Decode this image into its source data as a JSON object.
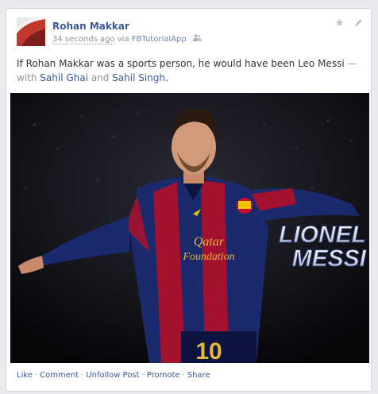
{
  "post": {
    "author": "Rohan Makkar",
    "time": "34 seconds ago",
    "via_label": "via",
    "app": "FBTutorialApp",
    "audience_icon": "friends-icon",
    "status_before": "If Rohan Makkar was a sports person, he would have been Leo Messi",
    "status_dash_with": " — with ",
    "tagged_1": "Sahil Ghai",
    "and_label": " and ",
    "tagged_2": "Sahil Singh",
    "period": ".",
    "photo": {
      "overlay_line1": "LIONEL",
      "overlay_line2": "MESSI",
      "jersey_text_1": "Qatar",
      "jersey_text_2": "Foundation",
      "jersey_number": "10"
    }
  },
  "icons": {
    "star": "star-icon",
    "edit": "pencil-icon"
  },
  "actions": {
    "like": "Like",
    "comment": "Comment",
    "unfollow": "Unfollow Post",
    "promote": "Promote",
    "share": "Share",
    "separator": "·"
  },
  "colors": {
    "link": "#3b5998",
    "muted": "#90949c",
    "jersey_blue": "#1a2a6c",
    "jersey_red": "#a3112e"
  }
}
